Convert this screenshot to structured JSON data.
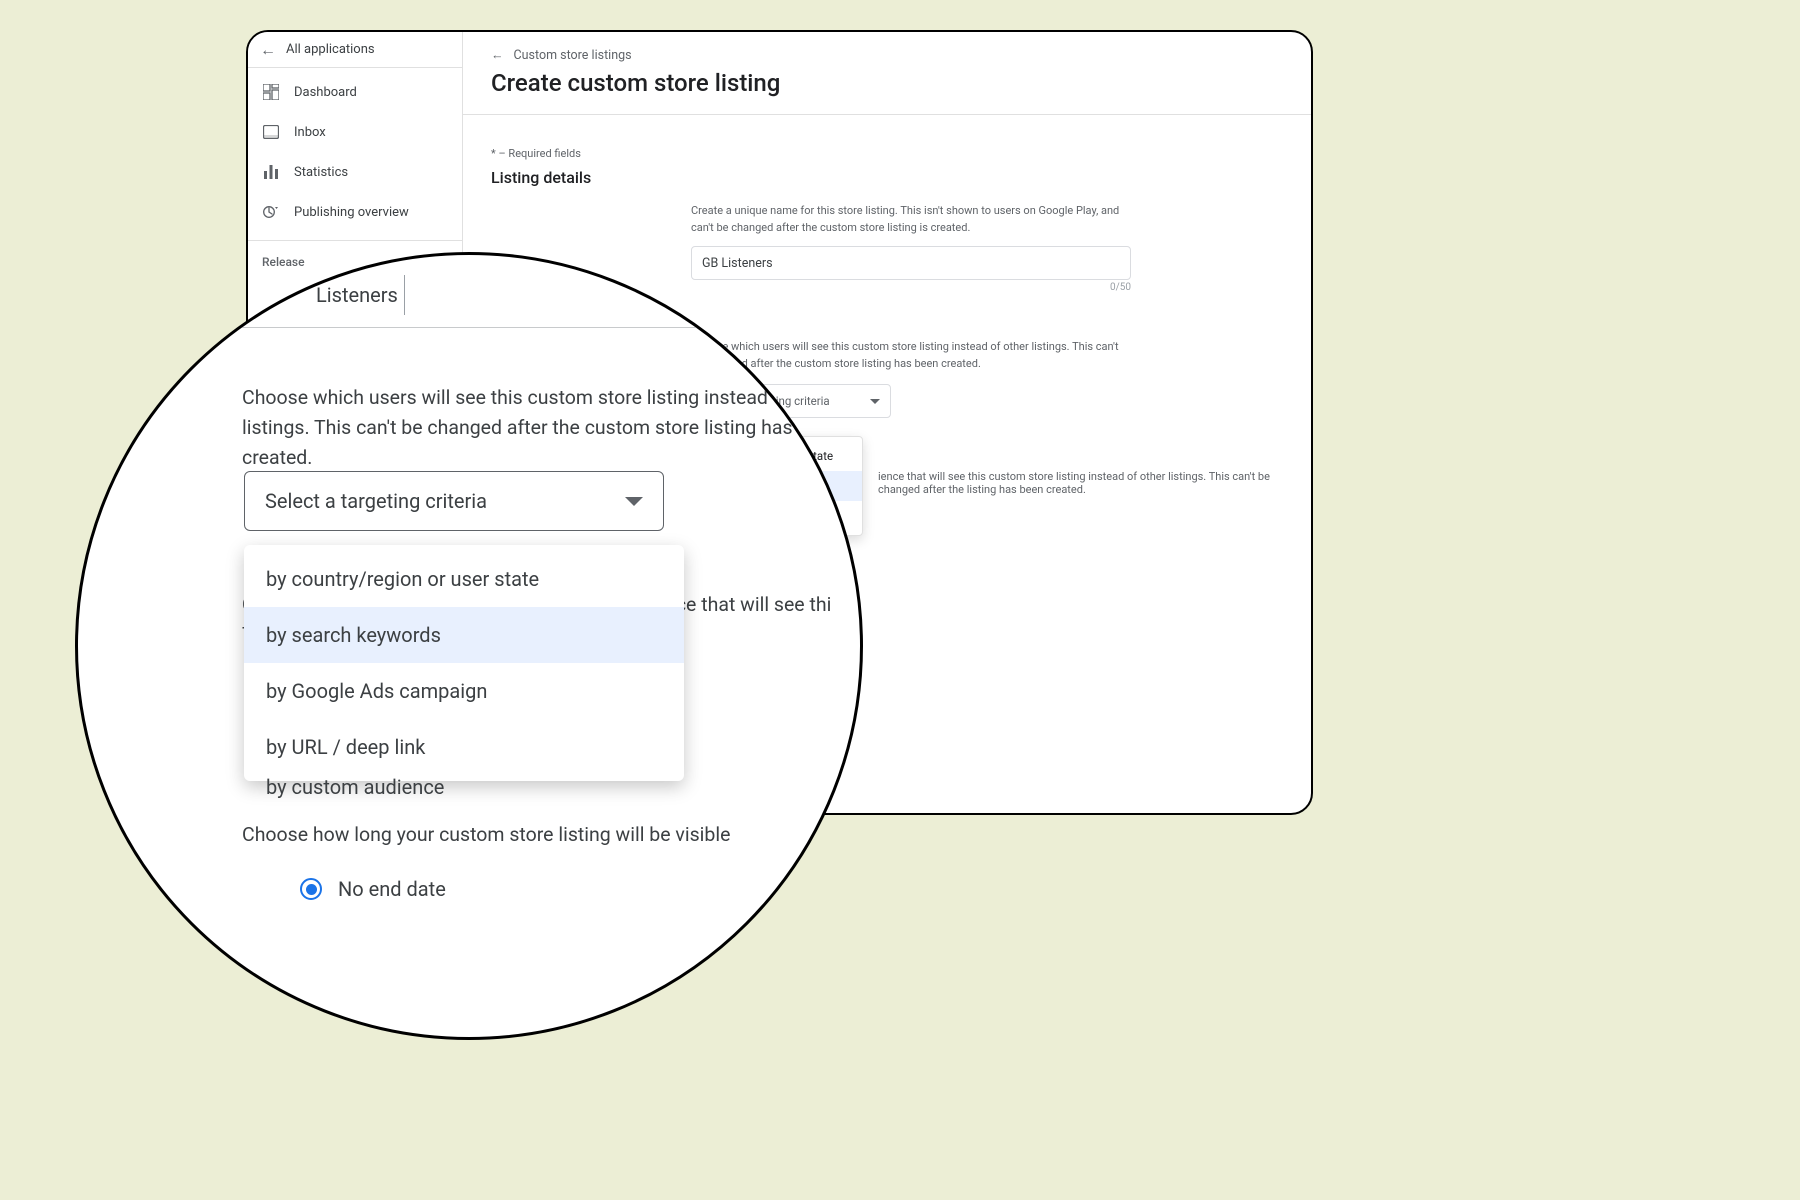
{
  "sidebar": {
    "back_label": "All applications",
    "items": [
      {
        "label": "Dashboard"
      },
      {
        "label": "Inbox"
      },
      {
        "label": "Statistics"
      },
      {
        "label": "Publishing overview"
      }
    ],
    "section": "Release"
  },
  "breadcrumb": {
    "label": "Custom store listings"
  },
  "page": {
    "title": "Create custom store listing"
  },
  "required_note": "* – Required fields",
  "section": {
    "title": "Listing details"
  },
  "name_field": {
    "help": "Create a unique name for this store listing. This isn't shown to users on Google Play, and can't be changed after the custom store listing is created.",
    "value": "GB Listeners",
    "counter": "0/50"
  },
  "targeting": {
    "help_small": "Choose which users will see this custom store listing instead of other listings. This can't be changed after the custom store listing has been created.",
    "help_large": "Choose which users will see this custom store listing instead of other listings. This can't be changed after the custom store listing has been created.",
    "select_placeholder": "Select a targeting criteria",
    "options": [
      "by country/region or user state",
      "by search keywords",
      "by Google Ads campaign",
      "by URL / deep link",
      "by custom audience"
    ],
    "selected_index": 1,
    "option_sm_0": "by country/region or user state",
    "option_sm_1": "by search keywords",
    "option_sm_2": "by Google Ads campaign",
    "option_lg_0": "by country/region or user state",
    "option_lg_1": "by search keywords",
    "option_lg_2": "by Google Ads campaign",
    "option_lg_3": "by URL / deep link",
    "option_lg_4": "by custom audience"
  },
  "audience": {
    "help_small_suffix": "ience that will see this custom store listing instead of other listings. This can't be changed after the listing has been created.",
    "help_large_prefix": "C",
    "help_large_prefix2": "T",
    "help_large_suffix": "ience that will see thi",
    "help_large_suffix2": "has been created."
  },
  "duration": {
    "help_small_suffix": "om store listing will be visible",
    "help_large": "Choose how long your custom store listing will be visible",
    "radio_label": "No end date"
  },
  "mag": {
    "listeners_value": "Listeners"
  }
}
